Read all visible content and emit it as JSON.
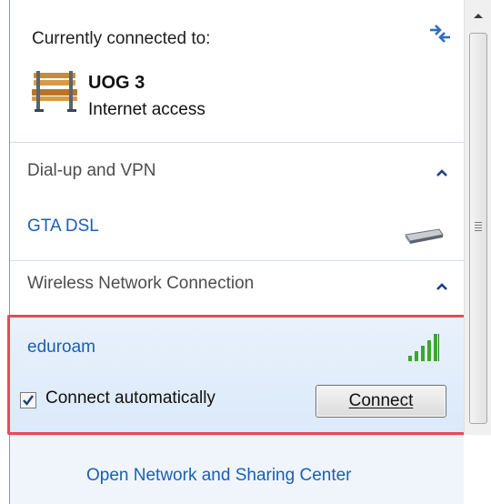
{
  "connected": {
    "heading": "Currently connected to:",
    "network_name": "UOG  3",
    "network_status": "Internet access"
  },
  "dialup": {
    "section_label": "Dial-up and VPN",
    "item_label": "GTA DSL"
  },
  "wireless": {
    "section_label": "Wireless Network Connection",
    "selected_network": "eduroam",
    "auto_connect_label": "Connect automatically",
    "auto_connect_checked": true,
    "connect_button_label": "Connect"
  },
  "footer": {
    "link_label": "Open Network and Sharing Center"
  },
  "colors": {
    "link": "#1a5fb4",
    "highlight_border": "#e84a55",
    "selected_bg": "#dbe9f9",
    "signal_green": "#3aa829"
  },
  "icons": {
    "refresh": "refresh-icon",
    "network": "bench-network-icon",
    "chevron": "chevron-up-icon",
    "modem": "modem-icon",
    "signal": "signal-strength-icon"
  }
}
